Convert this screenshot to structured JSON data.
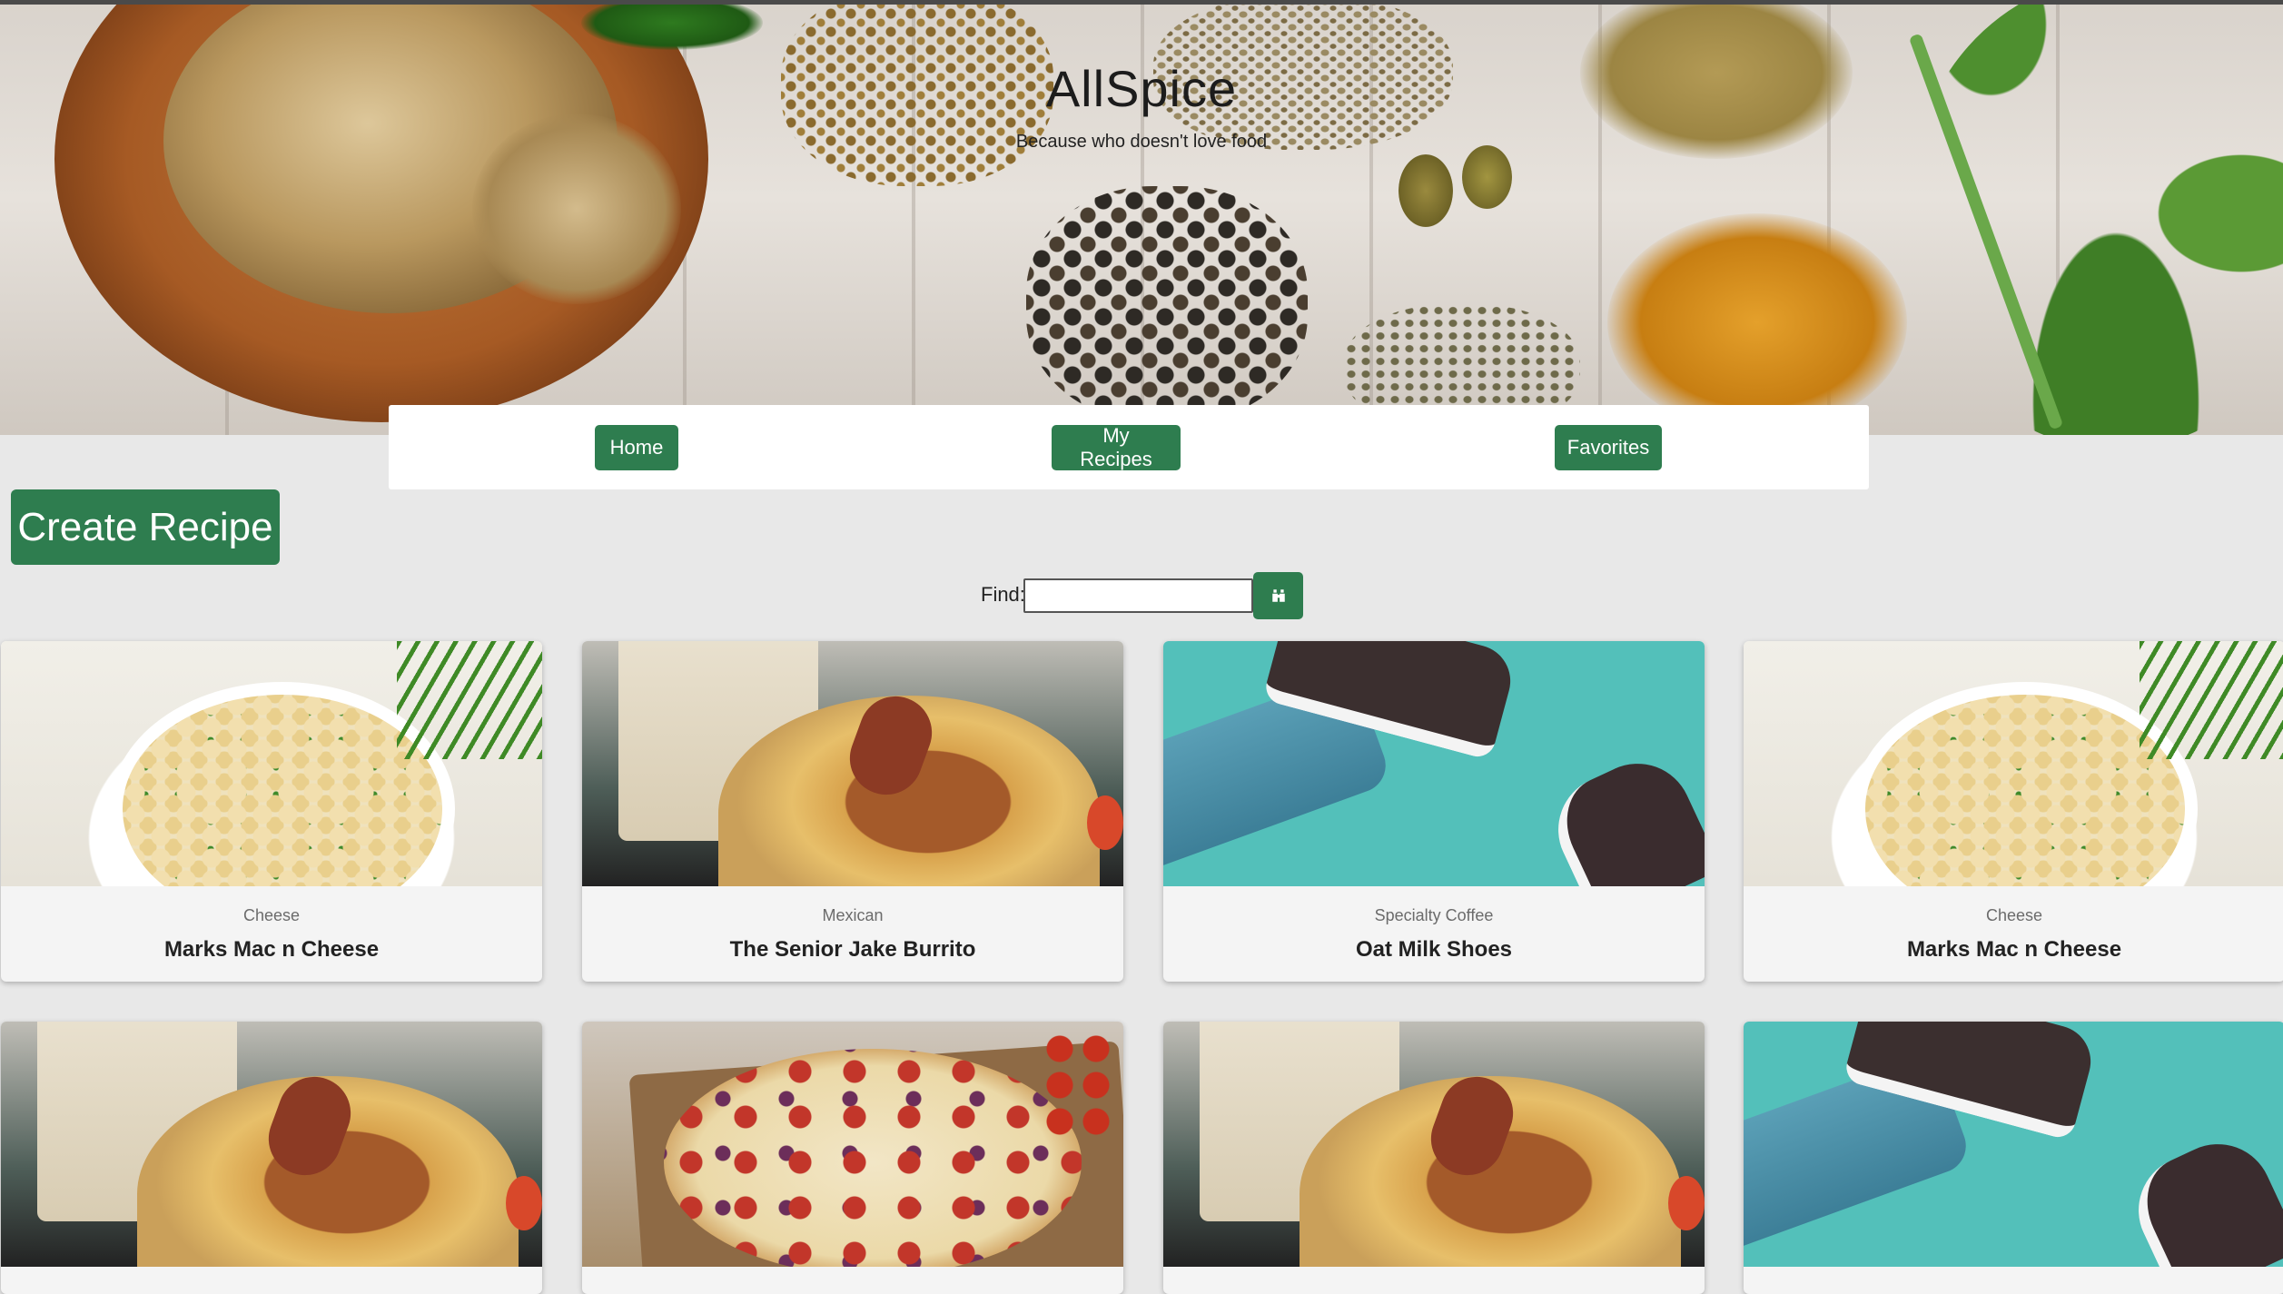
{
  "header": {
    "brand": "AllSpice",
    "tagline": "Because who doesn't love food"
  },
  "nav": {
    "home": "Home",
    "my_recipes": "My Recipes",
    "favorites": "Favorites"
  },
  "actions": {
    "create_recipe": "Create Recipe"
  },
  "search": {
    "label": "Find:",
    "value": "",
    "button_icon": "binoculars-icon"
  },
  "recipes": [
    {
      "category": "Cheese",
      "title": "Marks Mac n Cheese",
      "image": "mac-and-cheese-image"
    },
    {
      "category": "Mexican",
      "title": "The Senior Jake Burrito",
      "image": "burrito-image"
    },
    {
      "category": "Specialty Coffee",
      "title": "Oat Milk Shoes",
      "image": "shoes-image"
    },
    {
      "category": "Cheese",
      "title": "Marks Mac n Cheese",
      "image": "mac-and-cheese-image"
    },
    {
      "image": "burrito-image"
    },
    {
      "image": "pizza-image"
    },
    {
      "image": "burrito-image"
    },
    {
      "image": "shoes-image"
    }
  ],
  "colors": {
    "accent": "#2e7d4f",
    "page_background": "#e8e8e8",
    "card_background": "#f4f4f4"
  }
}
